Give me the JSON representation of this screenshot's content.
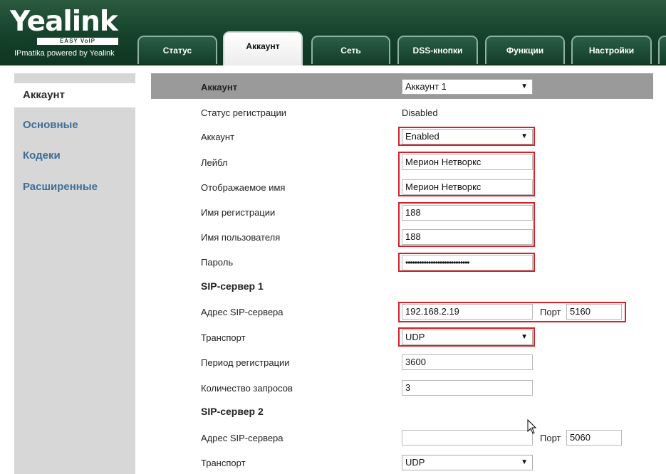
{
  "header": {
    "logo_text": "Yealink",
    "logo_tagline": "EASY VoIP",
    "logo_subtitle": "IPmatika powered by Yealink"
  },
  "tabs": [
    {
      "label": "Статус",
      "active": false
    },
    {
      "label": "Аккаунт",
      "active": true
    },
    {
      "label": "Сеть",
      "active": false
    },
    {
      "label": "DSS-кнопки",
      "active": false
    },
    {
      "label": "Функции",
      "active": false
    },
    {
      "label": "Настройки",
      "active": false
    }
  ],
  "sidebar": {
    "items": [
      {
        "label": "Аккаунт",
        "active": true
      },
      {
        "label": "Основные",
        "active": false
      },
      {
        "label": "Кодеки",
        "active": false
      },
      {
        "label": "Расширенные",
        "active": false
      }
    ]
  },
  "form": {
    "account_header_label": "Аккаунт",
    "account_select": "Аккаунт 1",
    "reg_status_label": "Статус регистрации",
    "reg_status_value": "Disabled",
    "account_active_label": "Аккаунт",
    "account_active_value": "Enabled",
    "label_label": "Лейбл",
    "label_value": "Мерион Нетворкс",
    "display_name_label": "Отображаемое имя",
    "display_name_value": "Мерион Нетворкс",
    "register_name_label": "Имя регистрации",
    "register_name_value": "188",
    "username_label": "Имя пользователя",
    "username_value": "188",
    "password_label": "Пароль",
    "password_value": "••••••••••••••••••••••••••••",
    "sip1": {
      "title": "SIP-сервер 1",
      "server_label": "Адрес SIP-сервера",
      "server_value": "192.168.2.19",
      "port_label": "Порт",
      "port_value": "5160",
      "transport_label": "Транспорт",
      "transport_value": "UDP",
      "reg_period_label": "Период регистрации",
      "reg_period_value": "3600",
      "retries_label": "Количество запросов",
      "retries_value": "3"
    },
    "sip2": {
      "title": "SIP-сервер 2",
      "server_label": "Адрес SIP-сервера",
      "server_value": "",
      "port_label": "Порт",
      "port_value": "5060",
      "transport_label": "Транспорт",
      "transport_value": "UDP"
    }
  },
  "colors": {
    "header_green": "#15412a",
    "highlight_red": "#d6212a",
    "sidebar_link": "#3f6e96",
    "sidebar_bg": "#d7d7d7",
    "table_header_bg": "#9a9a9a"
  }
}
